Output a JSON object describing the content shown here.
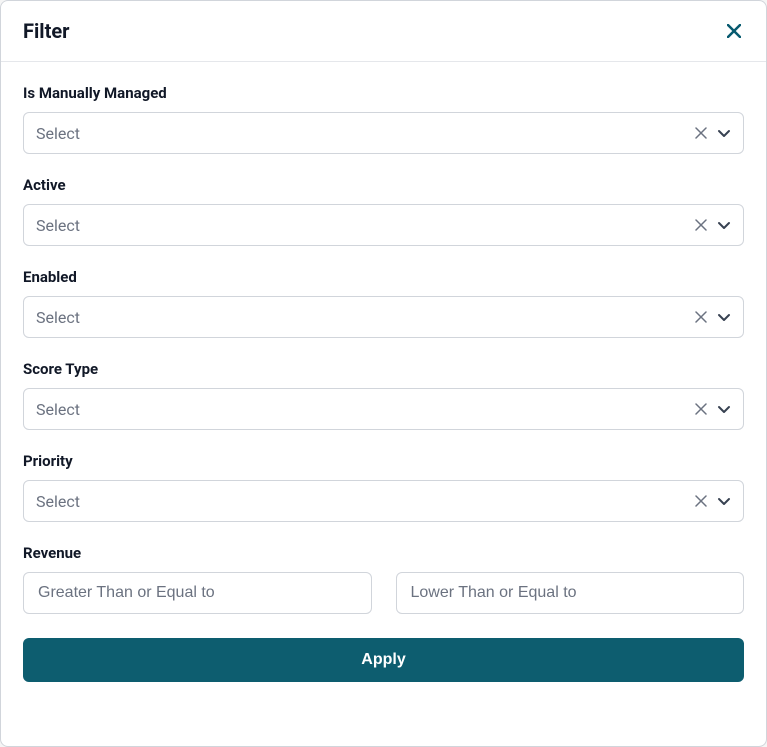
{
  "header": {
    "title": "Filter"
  },
  "fields": {
    "isManuallyManaged": {
      "label": "Is Manually Managed",
      "placeholder": "Select"
    },
    "active": {
      "label": "Active",
      "placeholder": "Select"
    },
    "enabled": {
      "label": "Enabled",
      "placeholder": "Select"
    },
    "scoreType": {
      "label": "Score Type",
      "placeholder": "Select"
    },
    "priority": {
      "label": "Priority",
      "placeholder": "Select"
    },
    "revenue": {
      "label": "Revenue",
      "minPlaceholder": "Greater Than or Equal to",
      "maxPlaceholder": "Lower Than or Equal to"
    }
  },
  "actions": {
    "apply": "Apply"
  }
}
